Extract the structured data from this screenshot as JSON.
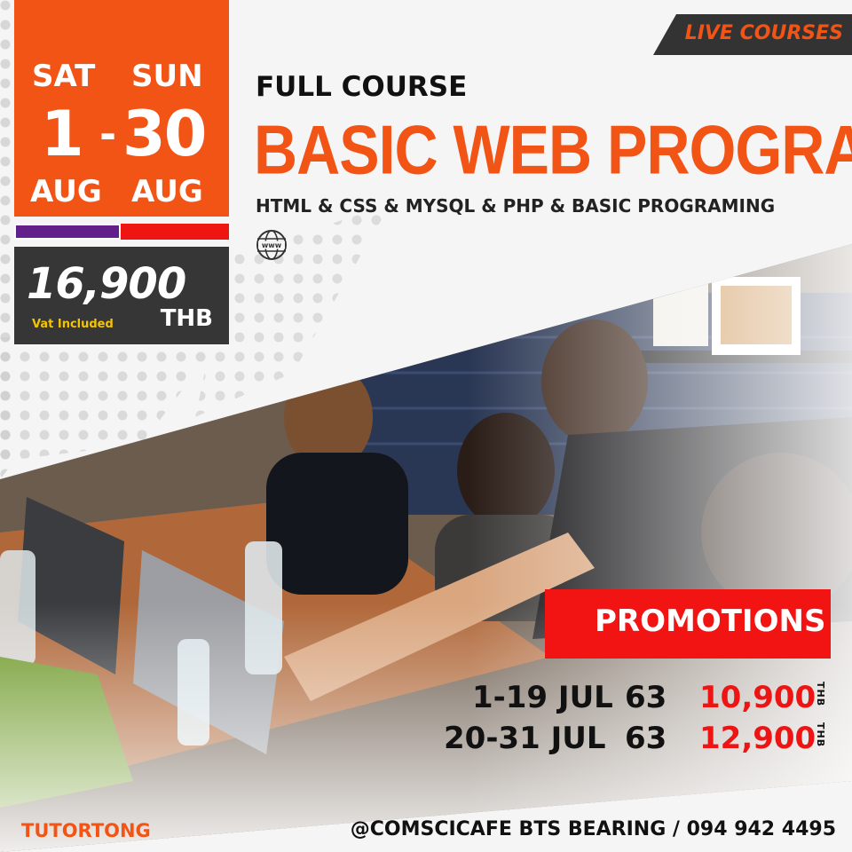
{
  "badge": {
    "live_courses": "LIVE COURSES"
  },
  "schedule": {
    "start_day": "SAT",
    "end_day": "SUN",
    "start_date": "1",
    "separator": "-",
    "end_date": "30",
    "start_month": "AUG",
    "end_month": "AUG"
  },
  "price": {
    "amount": "16,900",
    "vat_note": "Vat Included",
    "currency": "THB"
  },
  "heading": {
    "kicker": "FULL COURSE",
    "title": "BASIC WEB PROGRAMMING",
    "subtitle": "HTML & CSS & MYSQL & PHP & BASIC PROGRAMING",
    "globe_label": "www"
  },
  "promotions": {
    "label": "PROMOTIONS",
    "rows": [
      {
        "dates": "1-19 JUL",
        "year": "63",
        "price": "10,900",
        "unit": "THB"
      },
      {
        "dates": "20-31 JUL",
        "year": "63",
        "price": "12,900",
        "unit": "THB"
      }
    ]
  },
  "footer": {
    "brand": "TUTORTONG",
    "contact": "@COMSCICAFE BTS BEARING / 094 942 4495"
  },
  "colors": {
    "orange": "#f25415",
    "red": "#ef1512",
    "purple": "#63208a",
    "dark": "#363636",
    "yellow": "#f5c400"
  },
  "icons": [
    "globe-icon"
  ]
}
